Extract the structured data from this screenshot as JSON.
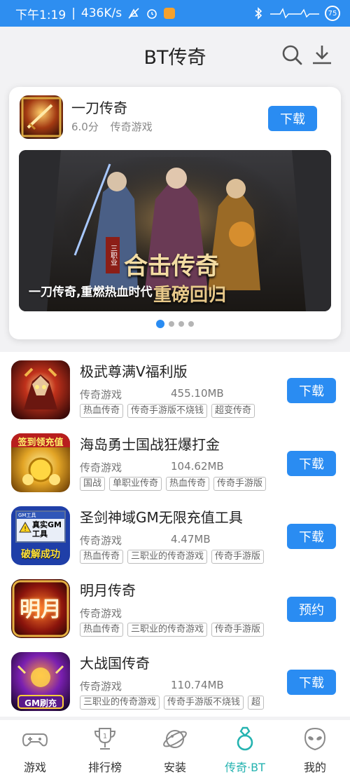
{
  "status_bar": {
    "time": "下午1:19",
    "separator": "|",
    "speed": "436K/s",
    "battery": "75"
  },
  "header": {
    "title": "BT传奇"
  },
  "featured": {
    "name": "一刀传奇",
    "score": "6.0分",
    "category": "传奇游戏",
    "button": "下载",
    "banner_caption": "一刀传奇,重燃热血时代",
    "banner_title_1": "合击传奇",
    "banner_title_2": "重磅回归",
    "banner_badge": "三职业",
    "dots": 4,
    "active_dot": 0
  },
  "games": [
    {
      "name": "极武尊满V福利版",
      "category": "传奇游戏",
      "size": "455.10MB",
      "button": "下载",
      "tags": [
        "热血传奇",
        "传奇手游版不烧钱",
        "超变传奇"
      ],
      "icon_text": ""
    },
    {
      "name": "海岛勇士国战狂爆打金",
      "category": "传奇游戏",
      "size": "104.62MB",
      "button": "下载",
      "tags": [
        "国战",
        "单职业传奇",
        "热血传奇",
        "传奇手游版"
      ],
      "icon_text": "签到领充值"
    },
    {
      "name": "圣剑神域GM无限充值工具",
      "category": "传奇游戏",
      "size": "4.47MB",
      "button": "下载",
      "tags": [
        "热血传奇",
        "三职业的传奇游戏",
        "传奇手游版"
      ],
      "icon_text": "真实GM工具",
      "icon_text_2": "破解成功",
      "icon_text_3": "GM工具"
    },
    {
      "name": "明月传奇",
      "category": "传奇游戏",
      "size": "",
      "button": "预约",
      "tags": [
        "热血传奇",
        "三职业的传奇游戏",
        "传奇手游版"
      ],
      "icon_text": "明月"
    },
    {
      "name": "大战国传奇",
      "category": "传奇游戏",
      "size": "110.74MB",
      "button": "下载",
      "tags": [
        "三职业的传奇游戏",
        "传奇手游版不烧钱",
        "超"
      ],
      "icon_text": "GM刷充"
    }
  ],
  "nav": [
    {
      "label": "游戏",
      "icon": "gamepad-icon"
    },
    {
      "label": "排行榜",
      "icon": "trophy-icon"
    },
    {
      "label": "安装",
      "icon": "planet-icon"
    },
    {
      "label": "传奇·BT",
      "icon": "ring-icon",
      "active": true
    },
    {
      "label": "我的",
      "icon": "alien-icon"
    }
  ],
  "colors": {
    "status_bar": "#2e8ef0",
    "button": "#2a8cf2",
    "active_nav": "#25b3b0"
  }
}
